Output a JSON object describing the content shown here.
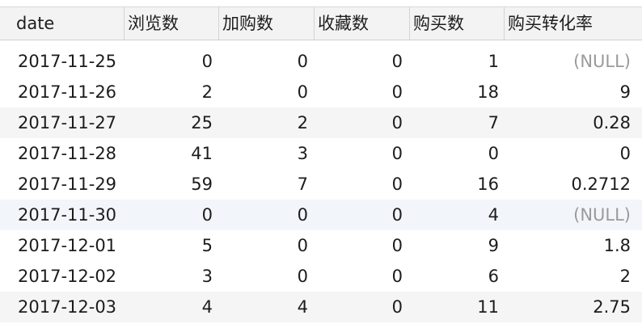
{
  "columns": [
    "date",
    "浏览数",
    "加购数",
    "收藏数",
    "购买数",
    "购买转化率"
  ],
  "rows": [
    {
      "date": "2017-11-25",
      "views": "0",
      "cart": "0",
      "fav": "0",
      "buy": "1",
      "rate": "(NULL)"
    },
    {
      "date": "2017-11-26",
      "views": "2",
      "cart": "0",
      "fav": "0",
      "buy": "18",
      "rate": "9"
    },
    {
      "date": "2017-11-27",
      "views": "25",
      "cart": "2",
      "fav": "0",
      "buy": "7",
      "rate": "0.28"
    },
    {
      "date": "2017-11-28",
      "views": "41",
      "cart": "3",
      "fav": "0",
      "buy": "0",
      "rate": "0"
    },
    {
      "date": "2017-11-29",
      "views": "59",
      "cart": "7",
      "fav": "0",
      "buy": "16",
      "rate": "0.2712"
    },
    {
      "date": "2017-11-30",
      "views": "0",
      "cart": "0",
      "fav": "0",
      "buy": "4",
      "rate": "(NULL)"
    },
    {
      "date": "2017-12-01",
      "views": "5",
      "cart": "0",
      "fav": "0",
      "buy": "9",
      "rate": "1.8"
    },
    {
      "date": "2017-12-02",
      "views": "3",
      "cart": "0",
      "fav": "0",
      "buy": "6",
      "rate": "2"
    },
    {
      "date": "2017-12-03",
      "views": "4",
      "cart": "4",
      "fav": "0",
      "buy": "11",
      "rate": "2.75"
    }
  ],
  "colors": {
    "header_bg": "#f3f3f3",
    "row_alt_bg": "#f5f5f5",
    "row_selected_bg": "#f2f6fb",
    "null_text": "#9a9a9a"
  }
}
